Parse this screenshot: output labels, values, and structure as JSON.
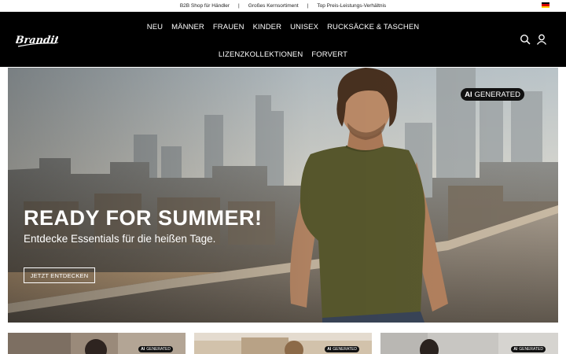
{
  "topbar": {
    "items": [
      "B2B Shop für Händler",
      "Großes Kernsortiment",
      "Top Preis-Leistungs-Verhältnis"
    ],
    "separator": "|",
    "flag_icon": "german-flag-icon"
  },
  "header": {
    "logo_text": "Brandit",
    "nav_row1": [
      "NEU",
      "MÄNNER",
      "FRAUEN",
      "KINDER",
      "UNISEX",
      "RUCKSÄCKE & TASCHEN"
    ],
    "nav_row2": [
      "LIZENZKOLLEKTIONEN",
      "FORVERT"
    ],
    "icons": [
      "search-icon",
      "account-icon"
    ]
  },
  "hero": {
    "badge_ai": "AI",
    "badge_text": "GENERATED",
    "title": "READY FOR SUMMER!",
    "subtitle": "Entdecke Essentials für die heißen Tage.",
    "cta": "JETZT ENTDECKEN"
  },
  "cards": [
    {
      "badge_ai": "AI",
      "badge_text": "GENERATED"
    },
    {
      "badge_ai": "AI",
      "badge_text": "GENERATED"
    },
    {
      "badge_ai": "AI",
      "badge_text": "GENERATED"
    }
  ],
  "colors": {
    "header_bg": "#000000",
    "shirt_olive": "#5a5a2e",
    "sky": "#c9cfd2"
  }
}
